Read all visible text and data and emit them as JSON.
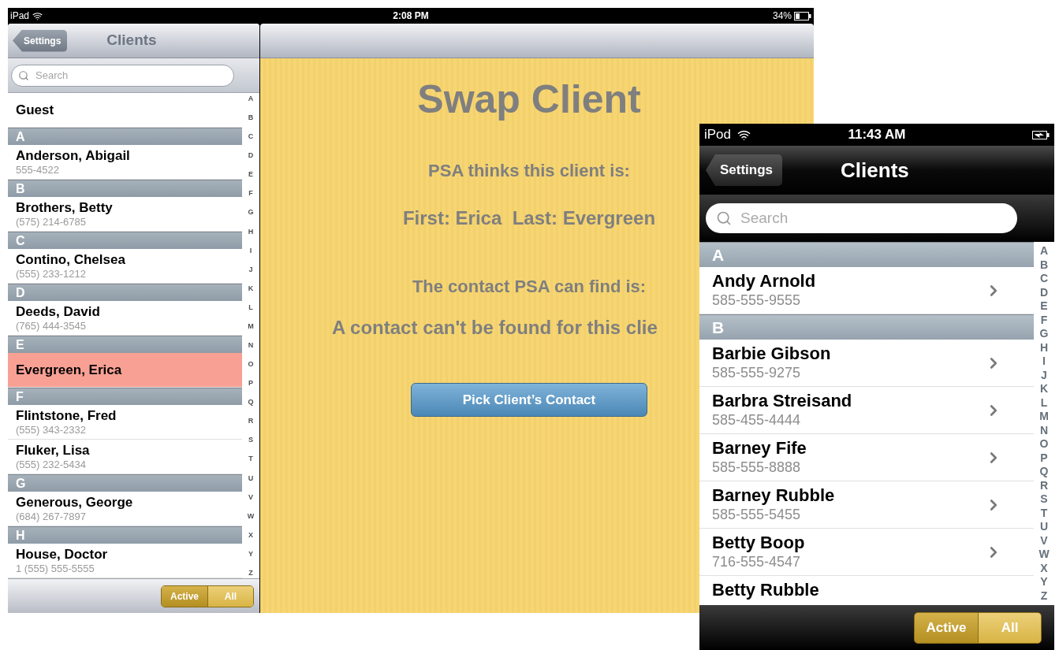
{
  "ipad": {
    "status_bar": {
      "device": "iPad",
      "time": "2:08 PM",
      "battery": "34%"
    },
    "nav": {
      "back": "Settings",
      "title": "Clients"
    },
    "search": {
      "placeholder": "Search"
    },
    "sections": [
      {
        "items": [
          {
            "name": "Guest",
            "selected": false
          }
        ]
      },
      {
        "header": "A",
        "items": [
          {
            "name": "Anderson, Abigail",
            "phone": "555-4522",
            "selected": false
          }
        ]
      },
      {
        "header": "B",
        "items": [
          {
            "name": "Brothers, Betty",
            "phone": "(575) 214-6785",
            "selected": false
          }
        ]
      },
      {
        "header": "C",
        "items": [
          {
            "name": "Contino, Chelsea",
            "phone": "(555) 233-1212",
            "selected": false
          }
        ]
      },
      {
        "header": "D",
        "items": [
          {
            "name": "Deeds, David",
            "phone": "(765) 444-3545",
            "selected": false
          }
        ]
      },
      {
        "header": "E",
        "items": [
          {
            "name": "Evergreen, Erica",
            "selected": true
          }
        ]
      },
      {
        "header": "F",
        "items": [
          {
            "name": "Flintstone, Fred",
            "phone": "(555) 343-2332",
            "selected": false
          },
          {
            "name": "Fluker, Lisa",
            "phone": "(555) 232-5434",
            "selected": false
          }
        ]
      },
      {
        "header": "G",
        "items": [
          {
            "name": "Generous, George",
            "phone": "(684) 267-7897",
            "selected": false
          }
        ]
      },
      {
        "header": "H",
        "items": [
          {
            "name": "House, Doctor",
            "phone": "1 (555) 555-5555",
            "selected": false
          }
        ]
      }
    ],
    "index": [
      "A",
      "B",
      "C",
      "D",
      "E",
      "F",
      "G",
      "H",
      "I",
      "J",
      "K",
      "L",
      "M",
      "N",
      "O",
      "P",
      "Q",
      "R",
      "S",
      "T",
      "U",
      "V",
      "W",
      "X",
      "Y",
      "Z"
    ],
    "segments": [
      {
        "label": "Active",
        "selected": true
      },
      {
        "label": "All",
        "selected": false
      }
    ],
    "detail": {
      "title": "Swap Client",
      "lines": [
        "PSA thinks this client is:",
        "First: Erica  Last: Evergreen",
        "The contact PSA can find is:",
        "A contact can't be found for this clie"
      ],
      "button": "Pick Client’s Contact"
    }
  },
  "ipod": {
    "status_bar": {
      "device": "iPod",
      "time": "11:43 AM"
    },
    "nav": {
      "back": "Settings",
      "title": "Clients"
    },
    "search": {
      "placeholder": "Search"
    },
    "sections": [
      {
        "header": "A",
        "items": [
          {
            "name": "Andy Arnold",
            "phone": "585-555-9555"
          }
        ]
      },
      {
        "header": "B",
        "items": [
          {
            "name": "Barbie Gibson",
            "phone": "585-555-9275"
          },
          {
            "name": "Barbra Streisand",
            "phone": "585-455-4444"
          },
          {
            "name": "Barney Fife",
            "phone": "585-555-8888"
          },
          {
            "name": "Barney Rubble",
            "phone": "585-555-5455"
          },
          {
            "name": "Betty Boop",
            "phone": "716-555-4547"
          },
          {
            "name": "Betty Rubble"
          }
        ]
      }
    ],
    "index": [
      "A",
      "B",
      "C",
      "D",
      "E",
      "F",
      "G",
      "H",
      "I",
      "J",
      "K",
      "L",
      "M",
      "N",
      "O",
      "P",
      "Q",
      "R",
      "S",
      "T",
      "U",
      "V",
      "W",
      "X",
      "Y",
      "Z"
    ],
    "segments": [
      {
        "label": "Active",
        "selected": true
      },
      {
        "label": "All",
        "selected": false
      }
    ]
  }
}
